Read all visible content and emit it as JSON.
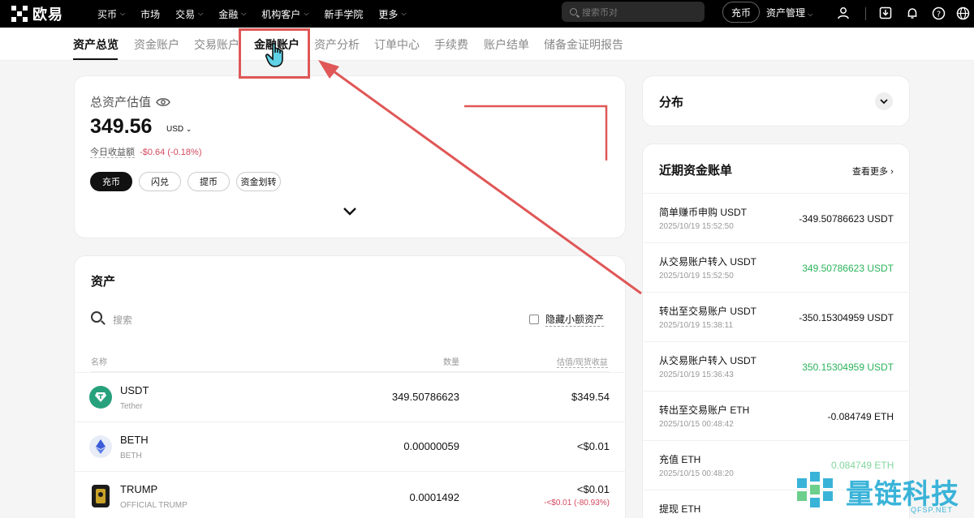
{
  "topbar": {
    "logo_text": "欧易",
    "nav": [
      {
        "label": "买币",
        "chevron": true
      },
      {
        "label": "市场",
        "chevron": false
      },
      {
        "label": "交易",
        "chevron": true
      },
      {
        "label": "金融",
        "chevron": true
      },
      {
        "label": "机构客户",
        "chevron": true
      },
      {
        "label": "新手学院",
        "chevron": false
      },
      {
        "label": "更多",
        "chevron": true
      }
    ],
    "search_placeholder": "搜索币对",
    "deposit_label": "充币",
    "asset_mgmt_label": "资产管理"
  },
  "subtabs": [
    "资产总览",
    "资金账户",
    "交易账户",
    "金融账户",
    "资产分析",
    "订单中心",
    "手续费",
    "账户结单",
    "储备金证明报告"
  ],
  "overview": {
    "title": "总资产估值",
    "total": "349.56",
    "currency": "USD",
    "today_label": "今日收益额",
    "today_value": "-$0.64 (-0.18%)",
    "actions": [
      "充币",
      "闪兑",
      "提币",
      "资金划转"
    ]
  },
  "distribution": {
    "title": "分布"
  },
  "recent_bills": {
    "title": "近期资金账单",
    "more": "查看更多",
    "rows": [
      {
        "name": "简单赚币申购 USDT",
        "time": "2025/10/19 15:52:50",
        "amount": "-349.50786623 USDT",
        "positive": false
      },
      {
        "name": "从交易账户转入 USDT",
        "time": "2025/10/19 15:52:50",
        "amount": "349.50786623 USDT",
        "positive": true
      },
      {
        "name": "转出至交易账户 USDT",
        "time": "2025/10/19 15:38:11",
        "amount": "-350.15304959 USDT",
        "positive": false
      },
      {
        "name": "从交易账户转入 USDT",
        "time": "2025/10/19 15:36:43",
        "amount": "350.15304959 USDT",
        "positive": true
      },
      {
        "name": "转出至交易账户 ETH",
        "time": "2025/10/15 00:48:42",
        "amount": "-0.084749 ETH",
        "positive": false
      },
      {
        "name": "充值 ETH",
        "time": "2025/10/15 00:48:20",
        "amount": "0.084749 ETH",
        "positive": true
      },
      {
        "name": "提现 ETH",
        "time": "",
        "amount": "",
        "positive": false
      }
    ]
  },
  "assets": {
    "title": "资产",
    "search_placeholder": "搜索",
    "hide_small": "隐藏小额资产",
    "headers": {
      "name": "名称",
      "qty": "数量",
      "value": "估值/现货收益"
    },
    "rows": [
      {
        "symbol": "USDT",
        "full": "Tether",
        "qty": "349.50786623",
        "value": "$349.54",
        "pnl": ""
      },
      {
        "symbol": "BETH",
        "full": "BETH",
        "qty": "0.00000059",
        "value": "<$0.01",
        "pnl": ""
      },
      {
        "symbol": "TRUMP",
        "full": "OFFICIAL TRUMP",
        "qty": "0.0001492",
        "value": "<$0.01",
        "pnl": "-<$0.01 (-80.93%)"
      }
    ]
  },
  "watermark": {
    "text": "量链科技",
    "sub": "QFSP.NET"
  },
  "colors": {
    "positive": "#2bb35a",
    "negative": "#d3485e",
    "annotation": "#e05757",
    "brand": "#000000"
  }
}
